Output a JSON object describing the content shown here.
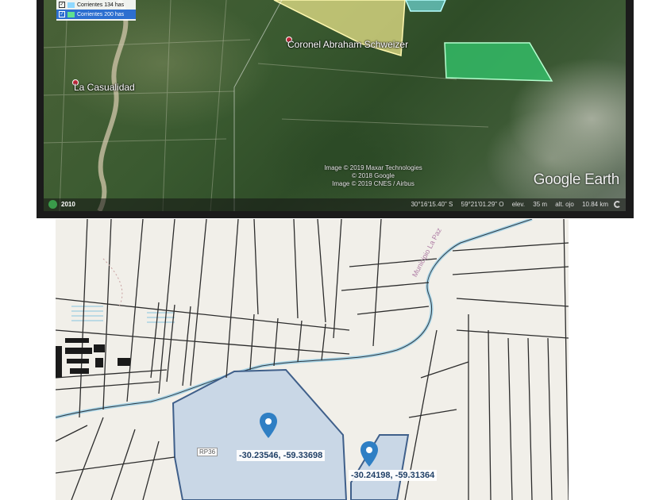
{
  "satellite": {
    "legend": [
      {
        "label": "Corrientes 134 has",
        "color": "#8fd8ff",
        "checked": true,
        "selected": false
      },
      {
        "label": "Corrientes 200 has",
        "color": "#60e090",
        "checked": true,
        "selected": true
      }
    ],
    "places": [
      {
        "name": "Coronel Abraham Schweizer"
      },
      {
        "name": "La Casualidad"
      }
    ],
    "credits": [
      "Image © 2019 Maxar Technologies",
      "© 2018 Google",
      "Image © 2019 CNES / Airbus"
    ],
    "logo": "Google Earth",
    "status": {
      "year": "2010",
      "latitude": "30°16'15.40\" S",
      "longitude": "59°21'01.29\" O",
      "elevation_label": "elev.",
      "elevation": "35 m",
      "eye_alt_label": "alt. ojo",
      "eye_alt": "10.84 km"
    },
    "colors": {
      "parcel_a": "#e8e38a",
      "parcel_b": "#6fd8d8",
      "parcel_c": "#33c26a"
    }
  },
  "cadastral": {
    "markers": [
      {
        "coords": "-30.23546, -59.33698"
      },
      {
        "coords": "-30.24198, -59.31364"
      }
    ],
    "municipality_label": "Municipio La Paz",
    "road_tag": "RP36",
    "colors": {
      "highlight_fill": "#c9d7e6",
      "highlight_stroke": "#3f5f8a",
      "pin": "#2f7fc4",
      "river": "#a8d4e6"
    }
  }
}
